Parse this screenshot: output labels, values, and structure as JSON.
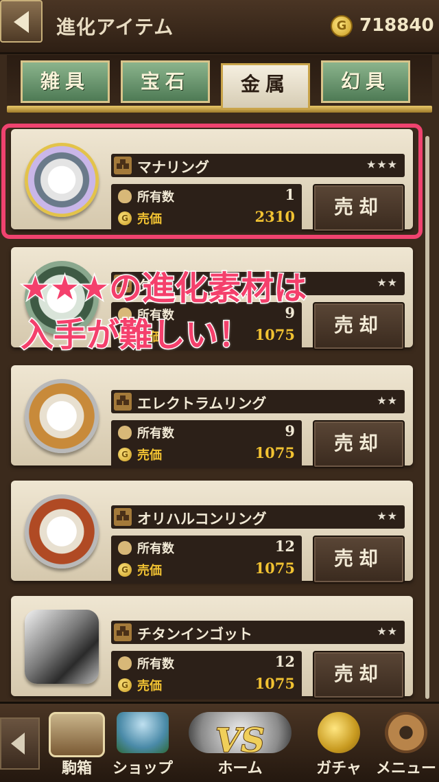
{
  "header": {
    "title": "進化アイテム",
    "gold_amount": "718840",
    "coin_symbol": "G"
  },
  "tabs": [
    {
      "label": "雑具",
      "active": false
    },
    {
      "label": "宝石",
      "active": false
    },
    {
      "label": "金属",
      "active": true
    },
    {
      "label": "幻具",
      "active": false
    }
  ],
  "items": [
    {
      "name": "マナリング",
      "stars": "★★★",
      "count_label": "所有数",
      "count": "1",
      "price_label": "売価",
      "price": "2310",
      "sell_label": "売却",
      "icon": "mana-ring-icon"
    },
    {
      "name": "ダ",
      "stars": "★★",
      "count_label": "所有数",
      "count": "9",
      "price_label": "売価",
      "price": "1075",
      "sell_label": "売却",
      "icon": "green-ring-icon"
    },
    {
      "name": "エレクトラムリング",
      "stars": "★★",
      "count_label": "所有数",
      "count": "9",
      "price_label": "売価",
      "price": "1075",
      "sell_label": "売却",
      "icon": "electrum-ring-icon"
    },
    {
      "name": "オリハルコンリング",
      "stars": "★★",
      "count_label": "所有数",
      "count": "12",
      "price_label": "売価",
      "price": "1075",
      "sell_label": "売却",
      "icon": "orichalcum-ring-icon"
    },
    {
      "name": "チタンインゴット",
      "stars": "★★",
      "count_label": "所有数",
      "count": "12",
      "price_label": "売価",
      "price": "1075",
      "sell_label": "売却",
      "icon": "titanium-ingot-icon"
    }
  ],
  "annotation": {
    "line1": "★★★の進化素材は",
    "line2": "入手が難しい！"
  },
  "nav": {
    "items": [
      {
        "label": "駒箱",
        "icon": "treasure-chest-icon"
      },
      {
        "label": "ショップ",
        "icon": "shop-icon"
      },
      {
        "label": "ホーム",
        "icon": "home-vs-icon",
        "badge": "VS"
      },
      {
        "label": "ガチャ",
        "icon": "gacha-coins-icon"
      },
      {
        "label": "メニュー",
        "icon": "gear-icon"
      }
    ]
  }
}
